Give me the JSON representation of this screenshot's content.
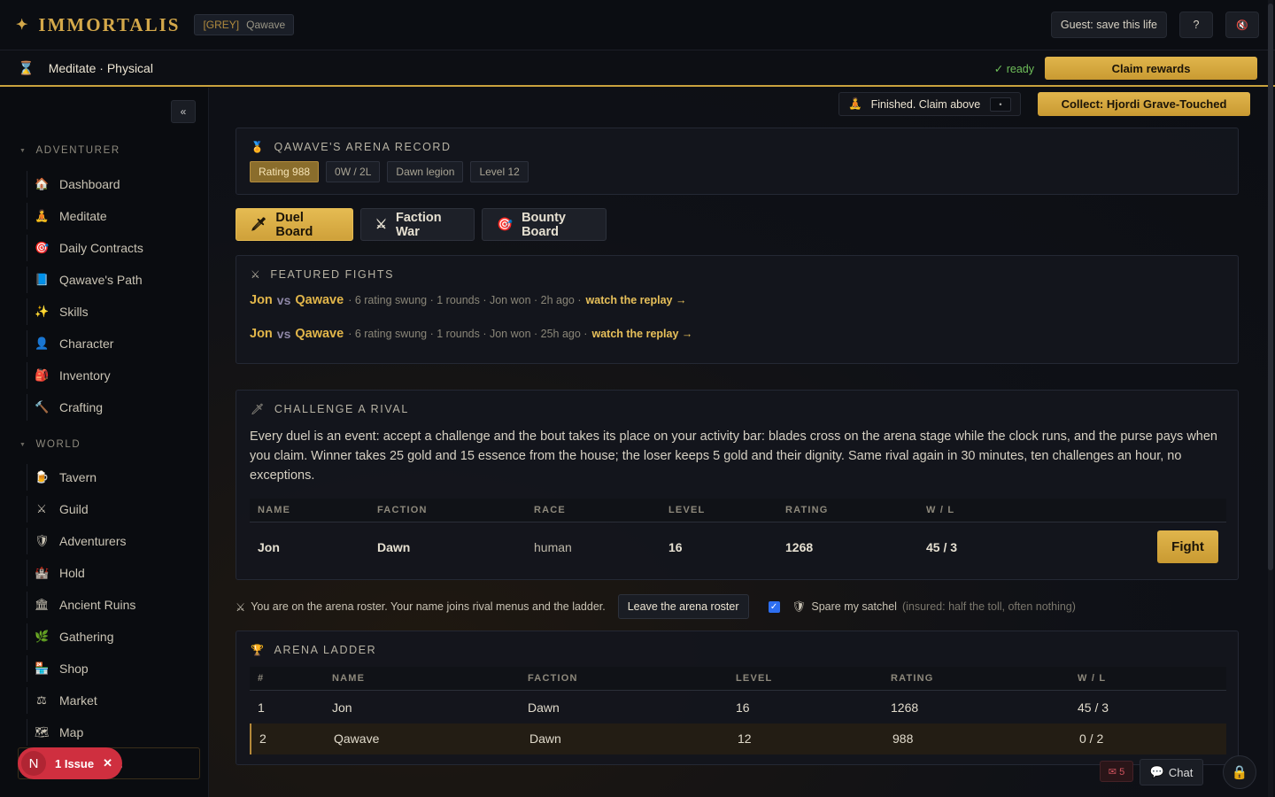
{
  "app": {
    "logo": "IMMORTALIS",
    "tag_grey": "[GREY]",
    "tag_name": "Qawave"
  },
  "topbar": {
    "guest_label": "Guest: save this life",
    "help_label": "?",
    "mute_icon": "🔇"
  },
  "activity": {
    "label": "Meditate · Physical",
    "status": "✓ ready",
    "claim_label": "Claim rewards"
  },
  "finished": {
    "label": "Finished. Claim above",
    "dot": "•"
  },
  "collect_label": "Collect: Hjordi Grave-Touched",
  "sidebar": {
    "collapse_label": "«",
    "sections": {
      "adventurer": "ADVENTURER",
      "world": "WORLD"
    },
    "adventurer_items": [
      {
        "label": "Dashboard",
        "icon": "🏠"
      },
      {
        "label": "Meditate",
        "icon": "🧘"
      },
      {
        "label": "Daily Contracts",
        "icon": "🎯"
      },
      {
        "label": "Qawave's Path",
        "icon": "📘"
      },
      {
        "label": "Skills",
        "icon": "✨"
      },
      {
        "label": "Character",
        "icon": "👤"
      },
      {
        "label": "Inventory",
        "icon": "🎒"
      },
      {
        "label": "Crafting",
        "icon": "🔨"
      }
    ],
    "world_items": [
      {
        "label": "Tavern",
        "icon": "🍺"
      },
      {
        "label": "Guild",
        "icon": "⚔"
      },
      {
        "label": "Adventurers",
        "icon": "🛡"
      },
      {
        "label": "Hold",
        "icon": "🏰"
      },
      {
        "label": "Ancient Ruins",
        "icon": "🏛"
      },
      {
        "label": "Gathering",
        "icon": "🌿"
      },
      {
        "label": "Shop",
        "icon": "🏪"
      },
      {
        "label": "Market",
        "icon": "⚖"
      },
      {
        "label": "Map",
        "icon": "🗺"
      },
      {
        "label": "World Boss",
        "icon": "🐉"
      }
    ]
  },
  "issue": {
    "letter": "N",
    "label": "1 Issue",
    "close": "✕"
  },
  "record": {
    "title": "QAWAVE'S ARENA RECORD",
    "chips": [
      "Rating 988",
      "0W / 2L",
      "Dawn legion",
      "Level 12"
    ]
  },
  "tabs": [
    {
      "label": "Duel Board",
      "icon": "🗡"
    },
    {
      "label": "Faction War",
      "icon": "⚔"
    },
    {
      "label": "Bounty Board",
      "icon": "🎯"
    }
  ],
  "featured": {
    "title": "FEATURED FIGHTS",
    "fights": [
      {
        "a": "Jon",
        "vs": "vs",
        "b": "Qawave",
        "meta": "· 6 rating swung · 1 rounds · Jon won · 2h ago ·",
        "replay": "watch the replay →"
      },
      {
        "a": "Jon",
        "vs": "vs",
        "b": "Qawave",
        "meta": "· 6 rating swung · 1 rounds · Jon won · 25h ago ·",
        "replay": "watch the replay →"
      }
    ]
  },
  "challenge": {
    "title": "CHALLENGE A RIVAL",
    "description": "Every duel is an event: accept a challenge and the bout takes its place on your activity bar: blades cross on the arena stage while the clock runs, and the purse pays when you claim. Winner takes 25 gold and 15 essence from the house; the loser keeps 5 gold and their dignity. Same rival again in 30 minutes, ten challenges an hour, no exceptions.",
    "headers": [
      "NAME",
      "FACTION",
      "RACE",
      "LEVEL",
      "RATING",
      "W / L"
    ],
    "rows": [
      {
        "name": "Jon",
        "faction": "Dawn",
        "race": "human",
        "level": "16",
        "rating": "1268",
        "wl": "45 / 3"
      }
    ],
    "fight_label": "Fight"
  },
  "roster": {
    "text": "You are on the arena roster. Your name joins rival menus and the ladder.",
    "leave_label": "Leave the arena roster",
    "spare_label": "Spare my satchel",
    "spare_note": "(insured: half the toll, often nothing)"
  },
  "ladder": {
    "title": "ARENA LADDER",
    "headers": [
      "#",
      "NAME",
      "FACTION",
      "LEVEL",
      "RATING",
      "W / L"
    ],
    "rows": [
      {
        "rank": "1",
        "name": "Jon",
        "faction": "Dawn",
        "level": "16",
        "rating": "1268",
        "wl": "45 / 3"
      },
      {
        "rank": "2",
        "name": "Qawave",
        "faction": "Dawn",
        "level": "12",
        "rating": "988",
        "wl": "0 / 2"
      }
    ]
  },
  "footer": {
    "mail_label": "✉ 5",
    "chat_label": "Chat"
  },
  "colors": {
    "accent": "#d4a84a",
    "ready": "#6fbf5a",
    "issue": "#cf2f3f"
  }
}
